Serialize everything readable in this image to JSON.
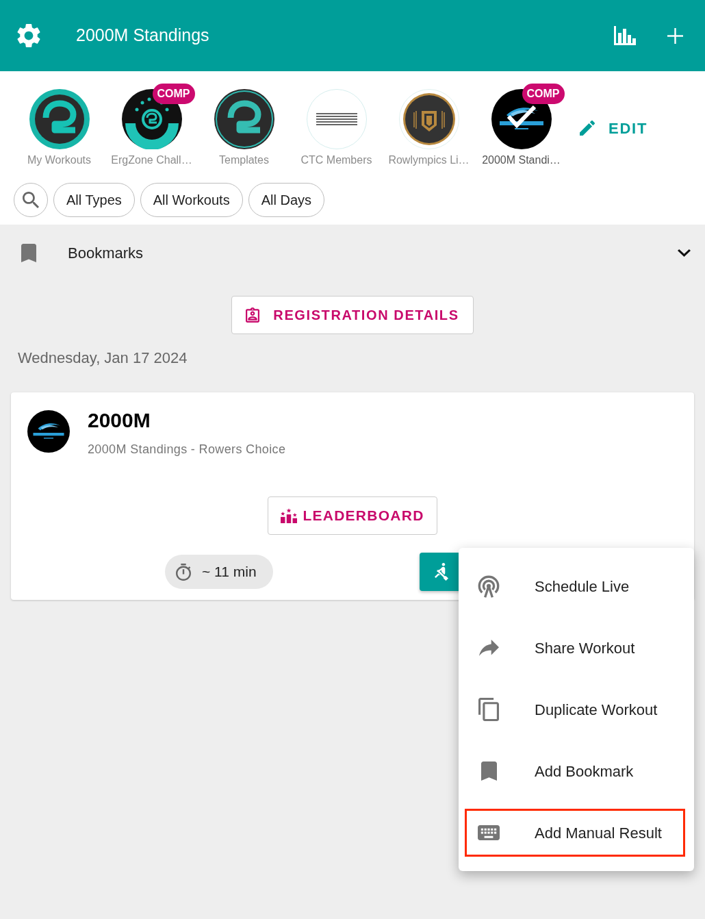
{
  "header": {
    "title": "2000M Standings"
  },
  "collections": [
    {
      "label": "My Workouts",
      "kind": "zone",
      "selected": false
    },
    {
      "label": "ErgZone Chall…",
      "kind": "challenge",
      "badge": "COMP",
      "selected": false
    },
    {
      "label": "Templates",
      "kind": "zonedark",
      "selected": false
    },
    {
      "label": "CTC Members",
      "kind": "stripes",
      "selected": false
    },
    {
      "label": "Rowlympics Li…",
      "kind": "shield",
      "selected": false
    },
    {
      "label": "2000M Standi…",
      "kind": "wave",
      "badge": "COMP",
      "selected": true
    }
  ],
  "edit_button": {
    "label": "EDIT"
  },
  "filters": [
    {
      "label": "All Types"
    },
    {
      "label": "All Workouts"
    },
    {
      "label": "All Days"
    }
  ],
  "bookmarks": {
    "label": "Bookmarks",
    "expanded": false
  },
  "registration_button": {
    "label": "REGISTRATION DETAILS"
  },
  "date": "Wednesday, Jan 17 2024",
  "workout": {
    "title": "2000M",
    "subtitle": "2000M Standings - Rowers Choice",
    "leaderboard_button": "LEADERBOARD",
    "duration": "~ 11 min"
  },
  "menu": [
    {
      "kind": "live",
      "label": "Schedule Live",
      "highlighted": false
    },
    {
      "kind": "share",
      "label": "Share Workout",
      "highlighted": false
    },
    {
      "kind": "duplicate",
      "label": "Duplicate Workout",
      "highlighted": false
    },
    {
      "kind": "bookmark",
      "label": "Add Bookmark",
      "highlighted": false
    },
    {
      "kind": "keyboard",
      "label": "Add Manual Result",
      "highlighted": true
    }
  ]
}
